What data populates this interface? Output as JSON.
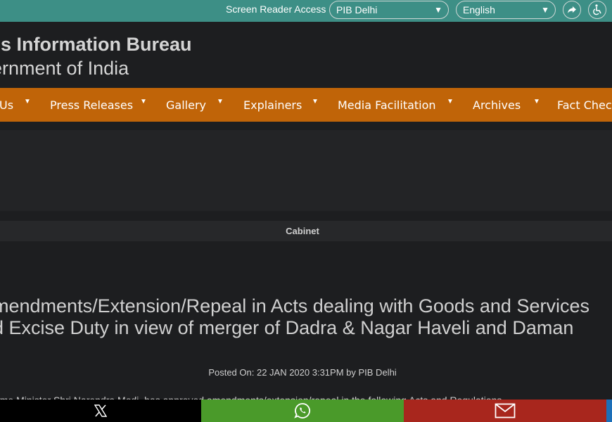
{
  "topbar": {
    "screen_reader": "Screen Reader Access",
    "region_select": "PIB Delhi",
    "language_select": "English",
    "share_icon": "share-arrow-icon",
    "accessibility_icon": "wheelchair-icon"
  },
  "header": {
    "title_line1": "ss Information Bureau",
    "title_line2": "ernment of India"
  },
  "nav": {
    "items": [
      "Us",
      "Press Releases",
      "Gallery",
      "Explainers",
      "Media Facilitation",
      "Archives",
      "Fact Check"
    ]
  },
  "article": {
    "category": "Cabinet",
    "title_line1": "mendments/Extension/Repeal in Acts dealing with Goods and Services",
    "title_line2": "d Excise Duty in view of merger of Dadra & Nagar Haveli and Daman",
    "posted": "Posted On: 22 JAN 2020 3:31PM by PIB Delhi",
    "paragraph": "rime Minister Shri Narendra Modi, has approved amendments/extension/repeal in the following Acts and Regulations"
  },
  "share_bar": {
    "icons": [
      "x-icon",
      "whatsapp-icon",
      "mail-icon"
    ]
  },
  "colors": {
    "topbar": "#3d8f86",
    "nav": "#c06408",
    "background": "#1d1e20"
  }
}
